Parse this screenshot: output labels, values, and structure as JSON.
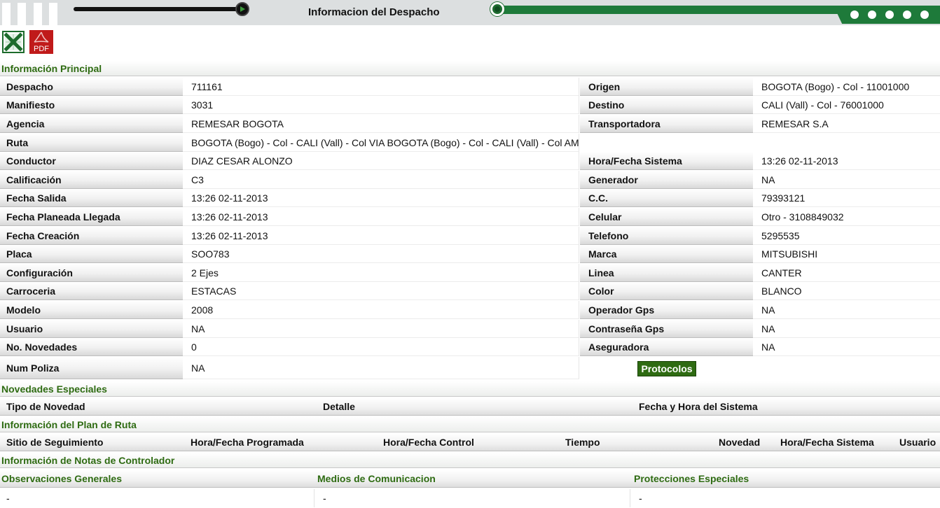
{
  "header": {
    "title": "Informacion del Despacho"
  },
  "export": {
    "excel_icon": "excel-icon",
    "pdf_icon": "pdf-icon",
    "pdf_text": "PDF"
  },
  "sections": {
    "principal": "Información Principal",
    "novedades": "Novedades Especiales",
    "plan_ruta": "Información del Plan de Ruta",
    "notas": "Información de Notas de Controlador"
  },
  "info_left": [
    {
      "label": "Despacho",
      "value": "711161"
    },
    {
      "label": "Manifiesto",
      "value": "3031"
    },
    {
      "label": "Agencia",
      "value": "REMESAR BOGOTA"
    },
    {
      "label": "Ruta",
      "value": "BOGOTA (Bogo) - Col - CALI (Vall) - Col VIA BOGOTA (Bogo) - Col - CALI (Vall) - Col AM"
    },
    {
      "label": "Conductor",
      "value": "DIAZ CESAR ALONZO"
    },
    {
      "label": "Calificación",
      "value": "C3"
    },
    {
      "label": "Fecha Salida",
      "value": "13:26 02-11-2013"
    },
    {
      "label": "Fecha Planeada Llegada",
      "value": "13:26 02-11-2013"
    },
    {
      "label": "Fecha Creación",
      "value": "13:26 02-11-2013"
    },
    {
      "label": "Placa",
      "value": "SOO783"
    },
    {
      "label": "Configuración",
      "value": "2 Ejes"
    },
    {
      "label": "Carroceria",
      "value": "ESTACAS"
    },
    {
      "label": "Modelo",
      "value": "2008"
    },
    {
      "label": "Usuario",
      "value": "NA"
    },
    {
      "label": "No. Novedades",
      "value": "0"
    },
    {
      "label": "Num Poliza",
      "value": "NA"
    }
  ],
  "info_right": [
    {
      "label": "Origen",
      "value": "BOGOTA (Bogo) - Col - 11001000"
    },
    {
      "label": "Destino",
      "value": "CALI (Vall) - Col - 76001000"
    },
    {
      "label": "Transportadora",
      "value": "REMESAR S.A"
    },
    {
      "label": "",
      "value": ""
    },
    {
      "label": "Hora/Fecha Sistema",
      "value": "13:26 02-11-2013"
    },
    {
      "label": "Generador",
      "value": "NA"
    },
    {
      "label": "C.C.",
      "value": "79393121"
    },
    {
      "label": "Celular",
      "value": "Otro - 3108849032"
    },
    {
      "label": "Telefono",
      "value": "5295535"
    },
    {
      "label": "Marca",
      "value": "MITSUBISHI"
    },
    {
      "label": "Linea",
      "value": "CANTER"
    },
    {
      "label": "Color",
      "value": "BLANCO"
    },
    {
      "label": "Operador Gps",
      "value": "NA"
    },
    {
      "label": "Contraseña Gps",
      "value": "NA"
    },
    {
      "label": "Aseguradora",
      "value": "NA"
    }
  ],
  "protocolos_button": "Protocolos",
  "novedades_cols": [
    "Tipo de Novedad",
    "Detalle",
    "Fecha y Hora del Sistema"
  ],
  "plan_ruta_cols": [
    "Sitio de Seguimiento",
    "Hora/Fecha Programada",
    "Hora/Fecha Control",
    "Tiempo",
    "Novedad",
    "Hora/Fecha Sistema",
    "Usuario"
  ],
  "notas_cols": [
    "Observaciones Generales",
    "Medios de Comunicacion",
    "Protecciones Especiales"
  ],
  "notas_values": [
    "-",
    "-",
    "-"
  ],
  "colors": {
    "section_green": "#2e6b12",
    "banner_green": "#1e7a3a",
    "banner_gray": "#dcdfe0"
  }
}
